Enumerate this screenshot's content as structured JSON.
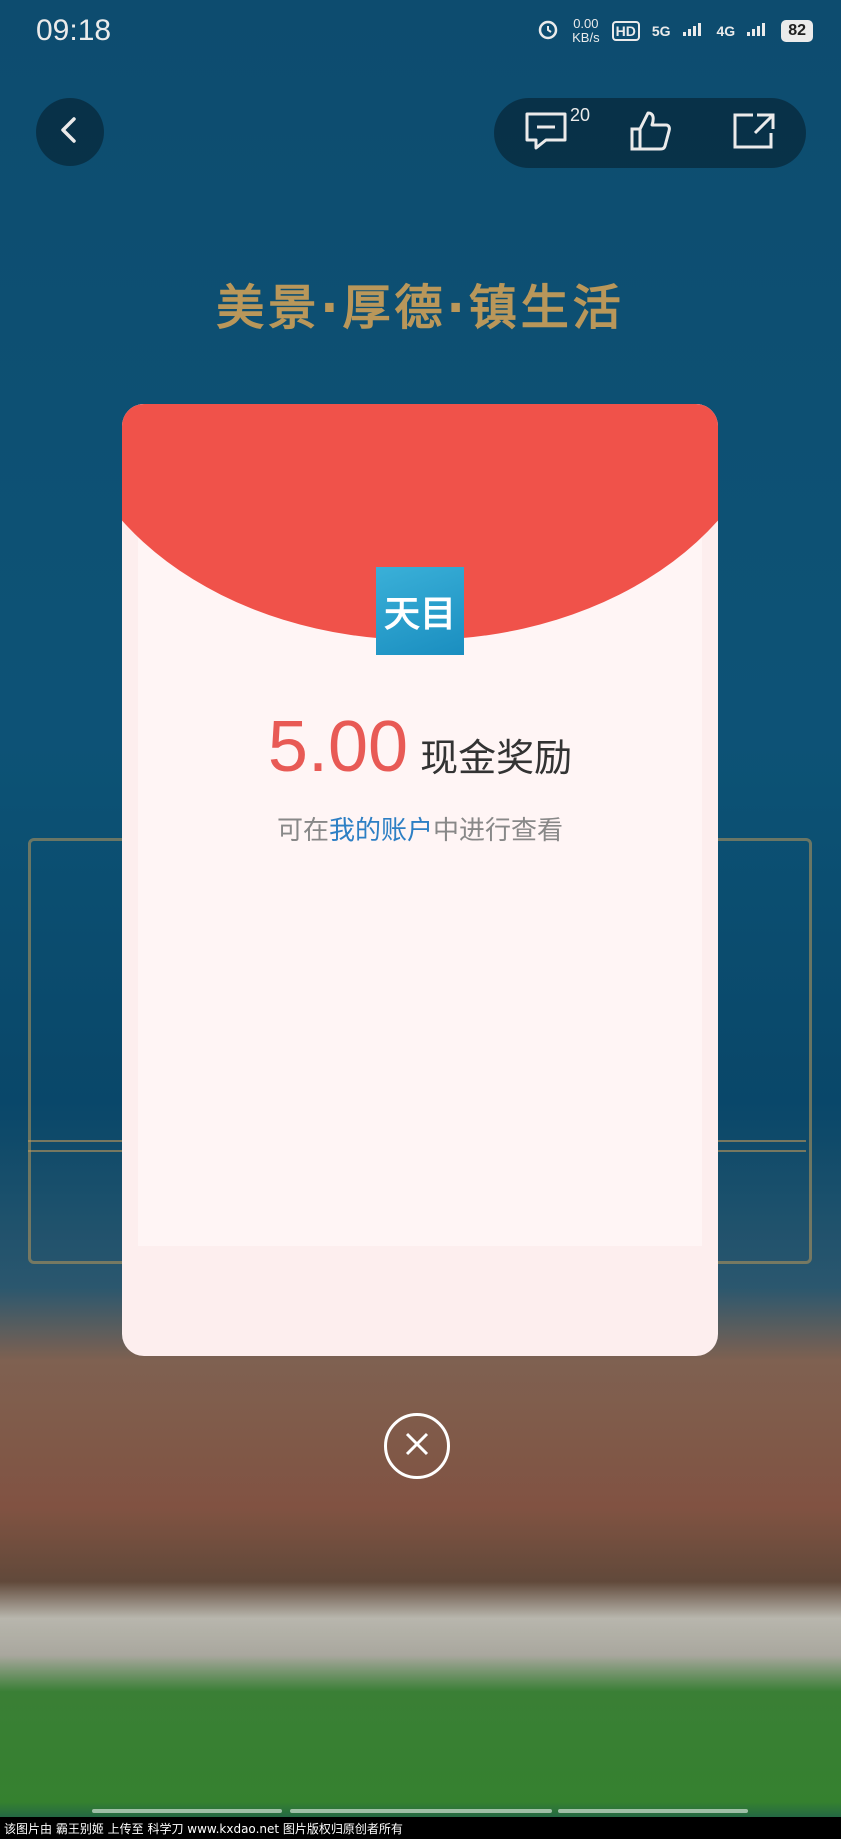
{
  "status_bar": {
    "time": "09:18",
    "net_speed_value": "0.00",
    "net_speed_unit": "KB/s",
    "hd_label": "HD",
    "signal_5g": "5G",
    "signal_4g": "4G",
    "battery": "82"
  },
  "toolbar": {
    "comment_count": "20"
  },
  "banner": {
    "title": "美景·厚德·镇生活"
  },
  "reward_modal": {
    "logo_text": "天目",
    "amount": "5.00",
    "reward_label": "现金奖励",
    "hint_prefix": "可在",
    "hint_link": "我的账户",
    "hint_suffix": "中进行查看"
  },
  "footer": {
    "watermark": "该图片由 霸王别姬 上传至 科学刀 www.kxdao.net 图片版权归原创者所有"
  },
  "colors": {
    "modal_header": "#f0524a",
    "amount": "#e85a55",
    "link": "#2d7fc4"
  }
}
